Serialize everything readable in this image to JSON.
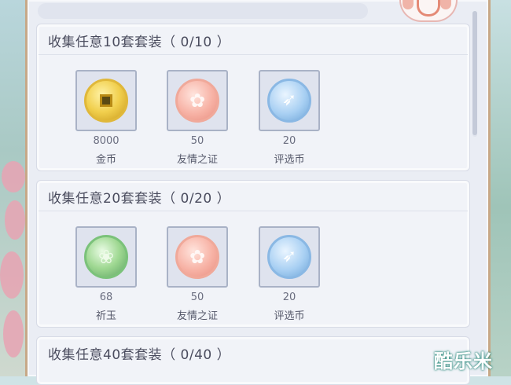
{
  "sections": [
    {
      "title": "收集任意10套套装（ 0/10 ）",
      "rewards": [
        {
          "icon": "gold-coin-icon",
          "amount": "8000",
          "name": "金币"
        },
        {
          "icon": "friendship-token-icon",
          "amount": "50",
          "name": "友情之证"
        },
        {
          "icon": "selection-coin-icon",
          "amount": "20",
          "name": "评选币"
        }
      ]
    },
    {
      "title": "收集任意20套套装（ 0/20 ）",
      "rewards": [
        {
          "icon": "jade-icon",
          "amount": "68",
          "name": "祈玉"
        },
        {
          "icon": "friendship-token-icon",
          "amount": "50",
          "name": "友情之证"
        },
        {
          "icon": "selection-coin-icon",
          "amount": "20",
          "name": "评选币"
        }
      ]
    },
    {
      "title": "收集任意40套套装（ 0/40 ）"
    }
  ],
  "watermark": "酷乐米",
  "colors": {
    "panel": "#eaedf4",
    "frame": "#c7a887",
    "title_text": "#4a4c5e",
    "item_border": "#a9b2c6"
  }
}
